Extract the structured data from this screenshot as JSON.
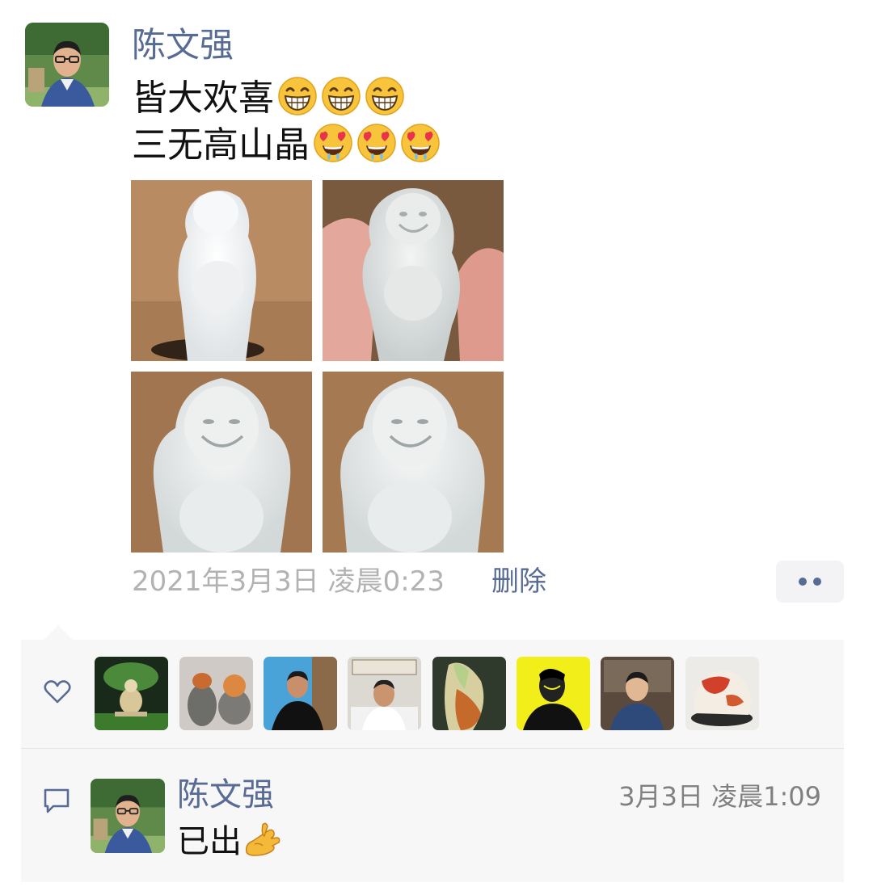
{
  "post": {
    "author": "陈文强",
    "line1": "皆大欢喜",
    "line1_emojis": [
      "grin-emoji",
      "grin-emoji",
      "grin-emoji"
    ],
    "line2": "三无高山晶",
    "line2_emojis": [
      "heart-eyes-drool-emoji",
      "heart-eyes-drool-emoji",
      "heart-eyes-drool-emoji"
    ],
    "photos": [
      "jade-buddha-photo",
      "jade-buddha-photo",
      "jade-buddha-photo",
      "jade-buddha-photo"
    ],
    "timestamp": "2021年3月3日 凌晨0:23",
    "delete_label": "删除"
  },
  "likes": {
    "icon": "heart-outline-icon",
    "avatars": [
      "buddha-statue-avatar",
      "stone-avatar",
      "man-chair-avatar",
      "man-office-avatar",
      "jade-piece-avatar",
      "yellow-portrait-avatar",
      "man-shelf-avatar",
      "red-stone-avatar"
    ]
  },
  "comment": {
    "icon": "comment-bubble-icon",
    "author": "陈文强",
    "time": "3月3日 凌晨1:09",
    "text": "已出",
    "emoji": "ok-hand-emoji"
  },
  "colors": {
    "link": "#576b95",
    "muted": "#b2b2b2",
    "panel": "#f7f7f7"
  }
}
